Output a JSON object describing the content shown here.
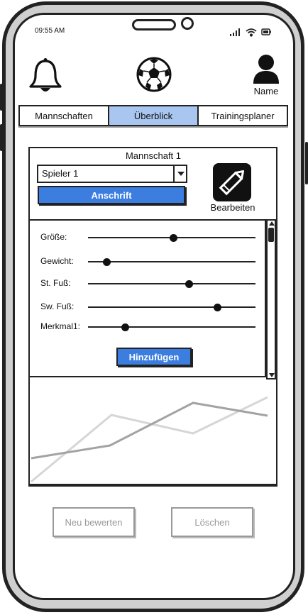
{
  "status": {
    "time": "09:55 AM"
  },
  "header": {
    "profile_name": "Name"
  },
  "tabs": [
    {
      "label": "Mannschaften",
      "active": false
    },
    {
      "label": "Überblick",
      "active": true
    },
    {
      "label": "Trainingsplaner",
      "active": false
    }
  ],
  "team": {
    "title": "Mannschaft 1"
  },
  "player_select": {
    "selected": "Spieler 1"
  },
  "buttons": {
    "address": "Anschrift",
    "edit": "Bearbeiten",
    "add": "Hinzufügen",
    "reassess": "Neu bewerten",
    "delete": "Löschen"
  },
  "sliders": [
    {
      "label": "Größe:",
      "value": 0.51
    },
    {
      "label": "Gewicht:",
      "value": 0.11
    },
    {
      "label": "St. Fuß:",
      "value": 0.6
    },
    {
      "label": "Sw. Fuß:",
      "value": 0.77
    },
    {
      "label": "Merkmal1:",
      "value": 0.22
    }
  ],
  "colors": {
    "accent": "#3b7ee0",
    "active_tab": "#a8c6ef"
  },
  "icons": [
    "bell-icon",
    "soccer-ball-icon",
    "user-icon",
    "pencil-icon"
  ]
}
